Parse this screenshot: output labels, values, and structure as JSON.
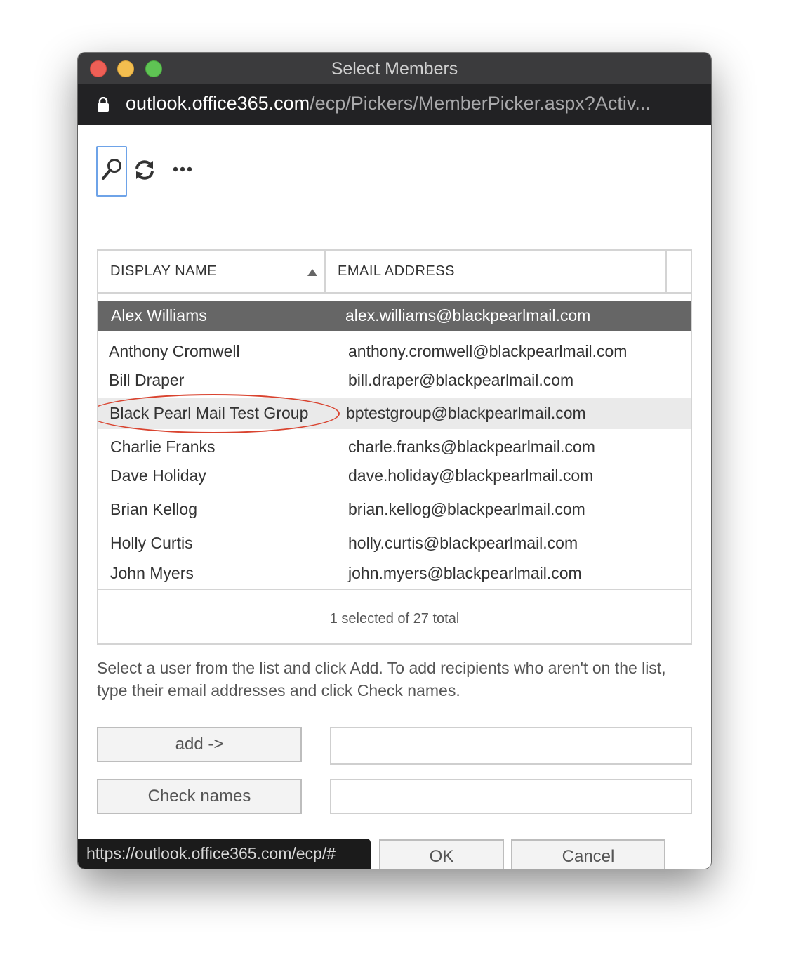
{
  "window": {
    "title": "Select Members",
    "url_host": "outlook.office365.com",
    "url_path": "/ecp/Pickers/MemberPicker.aspx?Activ..."
  },
  "toolbar": {
    "icons": [
      "search-icon",
      "refresh-icon",
      "more-icon"
    ]
  },
  "grid": {
    "columns": {
      "display_name": "DISPLAY NAME",
      "email_address": "EMAIL ADDRESS"
    },
    "sort": "ascending",
    "rows": [
      {
        "name": "Alex Williams",
        "email": "alex.williams@blackpearlmail.com",
        "state": "selected"
      },
      {
        "name": "Anthony Cromwell",
        "email": "anthony.cromwell@blackpearlmail.com",
        "state": "normal"
      },
      {
        "name": "Bill Draper",
        "email": "bill.draper@blackpearlmail.com",
        "state": "normal"
      },
      {
        "name": "Black Pearl Mail Test Group",
        "email": "bptestgroup@blackpearlmail.com",
        "state": "hover-highlighted"
      },
      {
        "name": "Charlie Franks",
        "email": "charle.franks@blackpearlmail.com",
        "state": "normal"
      },
      {
        "name": "Dave Holiday",
        "email": "dave.holiday@blackpearlmail.com",
        "state": "normal"
      },
      {
        "name": "Brian Kellog",
        "email": "brian.kellog@blackpearlmail.com",
        "state": "normal"
      },
      {
        "name": "Holly Curtis",
        "email": "holly.curtis@blackpearlmail.com",
        "state": "normal"
      },
      {
        "name": "John Myers",
        "email": "john.myers@blackpearlmail.com",
        "state": "normal"
      }
    ],
    "count_text": "1 selected of 27 total"
  },
  "instructions": "Select a user from the list and click Add. To add recipients who aren't on the list, type their email addresses and click Check names.",
  "buttons": {
    "add": "add ->",
    "check_names": "Check names",
    "ok": "OK",
    "cancel": "Cancel"
  },
  "fields": {
    "add_value": "",
    "check_value": ""
  },
  "status_bar": {
    "link": "https://outlook.office365.com/ecp/#"
  },
  "colors": {
    "selected_row": "#666666",
    "highlight_row": "#eaeaea",
    "annotation_oval": "#d9432f",
    "focus_border": "#6ea3e8"
  }
}
